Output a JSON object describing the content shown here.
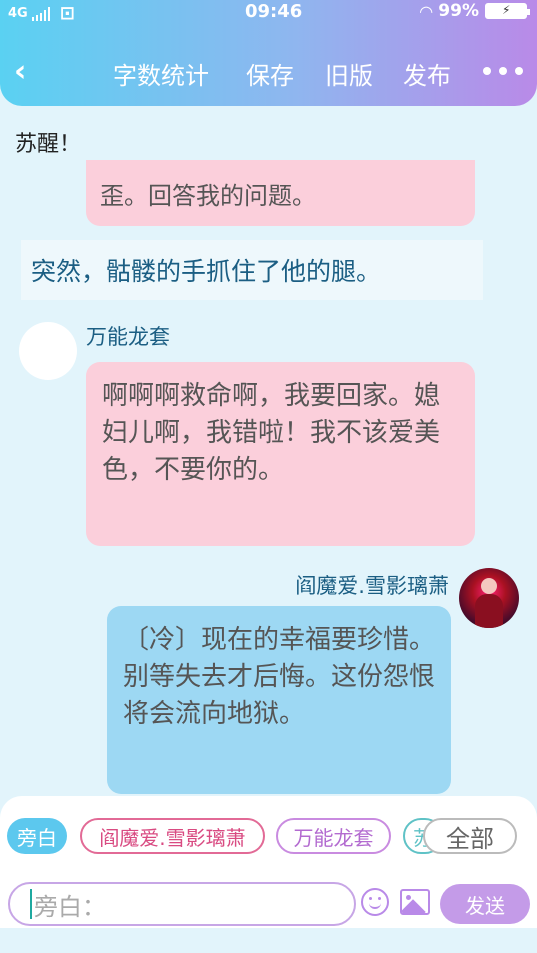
{
  "status_bar": {
    "network": "4G",
    "time": "09:46",
    "battery": "99%",
    "icons": [
      "signal-icon",
      "sim-icon",
      "wifi-icon",
      "battery-icon"
    ]
  },
  "nav": {
    "back_icon": "chevron-left-icon",
    "word_count": "字数统计",
    "save": "保存",
    "old_version": "旧版",
    "publish": "发布",
    "more_icon": "more-dots-icon"
  },
  "chat": {
    "partial_speaker": "苏醒！",
    "partial_bubble": "歪。回答我的问题。",
    "narration": "突然，骷髅的手抓住了他的腿。",
    "messages": [
      {
        "speaker": "万能龙套",
        "side": "left",
        "text": "啊啊啊救命啊，我要回家。媳妇儿啊，我错啦！我不该爱美色，不要你的。"
      },
      {
        "speaker": "阎魔爱.雪影璃萧",
        "side": "right",
        "text": "〔冷〕现在的幸福要珍惜。别等失去才后悔。这份怨恨将会流向地狱。"
      }
    ]
  },
  "roles": {
    "narration": "旁白",
    "role_a": "阎魔爱.雪影璃萧",
    "role_b": "万能龙套",
    "role_c": "苏",
    "all": "全部"
  },
  "composer": {
    "placeholder": "旁白：",
    "emoji_icon": "smile-icon",
    "image_icon": "image-icon",
    "send": "发送"
  },
  "colors": {
    "header_gradient": [
      "#5ad1f2",
      "#b98ae8"
    ],
    "pink_bubble": "#fbcfdb",
    "blue_bubble": "#9dd8f3",
    "accent": "#c49be8"
  }
}
